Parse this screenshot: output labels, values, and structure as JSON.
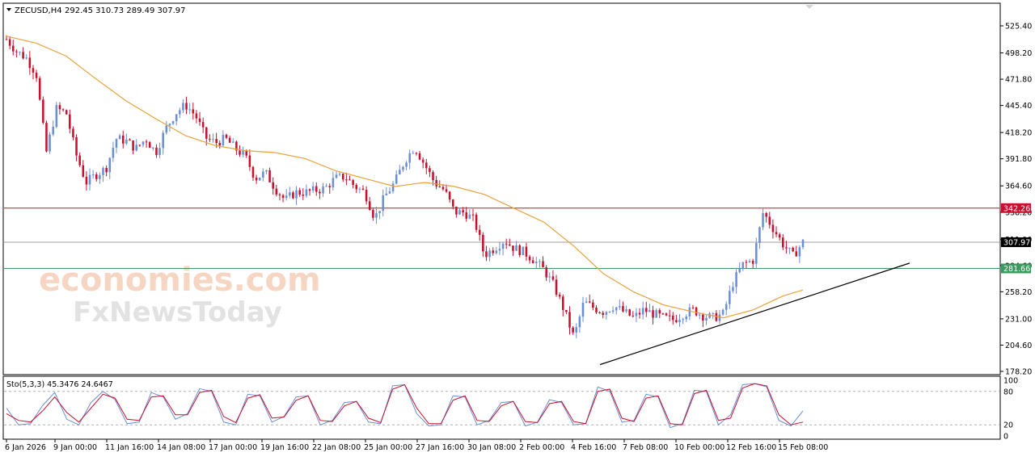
{
  "chart_data": {
    "type": "candlestick",
    "symbol_label": "ZECUSD,H4",
    "ohlc_label": "292.45 310.73 289.49 307.97",
    "y_ticks": [
      "525.40",
      "498.20",
      "471.80",
      "445.40",
      "418.20",
      "391.80",
      "364.60",
      "338.20",
      "311.00",
      "284.60",
      "258.20",
      "231.00",
      "204.60",
      "178.20"
    ],
    "y_range": [
      178.2,
      525.4
    ],
    "x_ticks": [
      "6 Jan 2026",
      "9 Jan 00:00",
      "11 Jan 16:00",
      "14 Jan 08:00",
      "17 Jan 00:00",
      "19 Jan 16:00",
      "22 Jan 08:00",
      "25 Jan 00:00",
      "27 Jan 16:00",
      "30 Jan 08:00",
      "2 Feb 00:00",
      "4 Feb 16:00",
      "7 Feb 08:00",
      "10 Feb 00:00",
      "12 Feb 16:00",
      "15 Feb 08:00"
    ],
    "horizontal_levels": [
      {
        "value": 342.26,
        "label": "342.26",
        "color": "#c8102e"
      },
      {
        "value": 307.97,
        "label": "307.97",
        "color": "#9e9e9e"
      },
      {
        "value": 281.66,
        "label": "281.66",
        "color": "#3c9a5f"
      }
    ],
    "trendline": {
      "from": {
        "x": "4 Feb 16:00",
        "y": 185
      },
      "to": {
        "x": "17 Feb 08:00",
        "y": 287
      },
      "color": "#000000"
    },
    "moving_average_color": "#e8a33c",
    "bull_color": "#6b8fd6",
    "bear_color": "#c8102e",
    "price_path": [
      [
        0,
        512
      ],
      [
        1,
        500
      ],
      [
        2,
        493
      ],
      [
        3,
        477
      ],
      [
        4,
        398
      ],
      [
        5,
        442
      ],
      [
        6,
        438
      ],
      [
        7,
        396
      ],
      [
        8,
        368
      ],
      [
        9,
        376
      ],
      [
        10,
        382
      ],
      [
        11,
        412
      ],
      [
        12,
        410
      ],
      [
        13,
        402
      ],
      [
        14,
        412
      ],
      [
        15,
        398
      ],
      [
        16,
        422
      ],
      [
        17,
        438
      ],
      [
        18,
        446
      ],
      [
        19,
        435
      ],
      [
        20,
        413
      ],
      [
        21,
        408
      ],
      [
        22,
        412
      ],
      [
        23,
        402
      ],
      [
        24,
        394
      ],
      [
        25,
        372
      ],
      [
        26,
        378
      ],
      [
        27,
        362
      ],
      [
        28,
        350
      ],
      [
        29,
        358
      ],
      [
        30,
        358
      ],
      [
        31,
        360
      ],
      [
        32,
        362
      ],
      [
        33,
        372
      ],
      [
        34,
        374
      ],
      [
        35,
        364
      ],
      [
        36,
        358
      ],
      [
        37,
        332
      ],
      [
        38,
        354
      ],
      [
        39,
        368
      ],
      [
        40,
        390
      ],
      [
        41,
        404
      ],
      [
        42,
        386
      ],
      [
        43,
        368
      ],
      [
        44,
        360
      ],
      [
        45,
        338
      ],
      [
        46,
        338
      ],
      [
        47,
        330
      ],
      [
        48,
        295
      ],
      [
        49,
        302
      ],
      [
        50,
        310
      ],
      [
        51,
        302
      ],
      [
        52,
        298
      ],
      [
        53,
        290
      ],
      [
        54,
        280
      ],
      [
        55,
        264
      ],
      [
        56,
        240
      ],
      [
        57,
        212
      ],
      [
        58,
        248
      ],
      [
        59,
        242
      ],
      [
        60,
        238
      ],
      [
        61,
        244
      ],
      [
        62,
        238
      ],
      [
        63,
        232
      ],
      [
        64,
        240
      ],
      [
        65,
        236
      ],
      [
        66,
        232
      ],
      [
        67,
        230
      ],
      [
        68,
        236
      ],
      [
        69,
        240
      ],
      [
        70,
        234
      ],
      [
        71,
        232
      ],
      [
        72,
        236
      ],
      [
        73,
        268
      ],
      [
        74,
        286
      ],
      [
        75,
        290
      ],
      [
        76,
        338
      ],
      [
        77,
        322
      ],
      [
        78,
        306
      ],
      [
        79,
        294
      ],
      [
        80,
        307.97
      ]
    ],
    "ma_path": [
      [
        0,
        515
      ],
      [
        3,
        508
      ],
      [
        6,
        495
      ],
      [
        9,
        472
      ],
      [
        12,
        450
      ],
      [
        15,
        432
      ],
      [
        18,
        415
      ],
      [
        21,
        405
      ],
      [
        24,
        400
      ],
      [
        27,
        398
      ],
      [
        30,
        392
      ],
      [
        33,
        380
      ],
      [
        36,
        372
      ],
      [
        39,
        364
      ],
      [
        42,
        368
      ],
      [
        45,
        364
      ],
      [
        48,
        356
      ],
      [
        51,
        342
      ],
      [
        54,
        328
      ],
      [
        57,
        304
      ],
      [
        60,
        276
      ],
      [
        63,
        258
      ],
      [
        66,
        245
      ],
      [
        69,
        238
      ],
      [
        72,
        232
      ],
      [
        75,
        240
      ],
      [
        78,
        254
      ],
      [
        80,
        260
      ]
    ],
    "stochastic": {
      "label": "Sto(5,3,3) 45.3476 24.6467",
      "levels": [
        "100",
        "80",
        "20",
        "0"
      ],
      "main": [
        50,
        20,
        22,
        55,
        78,
        30,
        20,
        60,
        80,
        65,
        22,
        25,
        78,
        70,
        30,
        40,
        85,
        80,
        25,
        20,
        75,
        72,
        25,
        35,
        70,
        72,
        20,
        28,
        60,
        62,
        25,
        22,
        90,
        92,
        40,
        18,
        20,
        72,
        70,
        20,
        28,
        60,
        62,
        18,
        25,
        65,
        60,
        20,
        22,
        88,
        80,
        25,
        28,
        75,
        70,
        15,
        22,
        82,
        80,
        20,
        38,
        92,
        94,
        88,
        28,
        18,
        45
      ],
      "signal": [
        40,
        28,
        25,
        45,
        70,
        42,
        25,
        50,
        75,
        68,
        30,
        28,
        70,
        72,
        38,
        38,
        78,
        82,
        35,
        24,
        68,
        74,
        32,
        34,
        64,
        72,
        28,
        26,
        54,
        62,
        32,
        24,
        84,
        92,
        50,
        22,
        22,
        64,
        72,
        28,
        26,
        54,
        62,
        26,
        24,
        58,
        62,
        26,
        22,
        80,
        84,
        32,
        26,
        68,
        72,
        22,
        20,
        76,
        82,
        28,
        32,
        86,
        94,
        90,
        38,
        20,
        25
      ]
    },
    "watermark_lines": [
      "economies.com",
      "FxNewsToday"
    ]
  }
}
